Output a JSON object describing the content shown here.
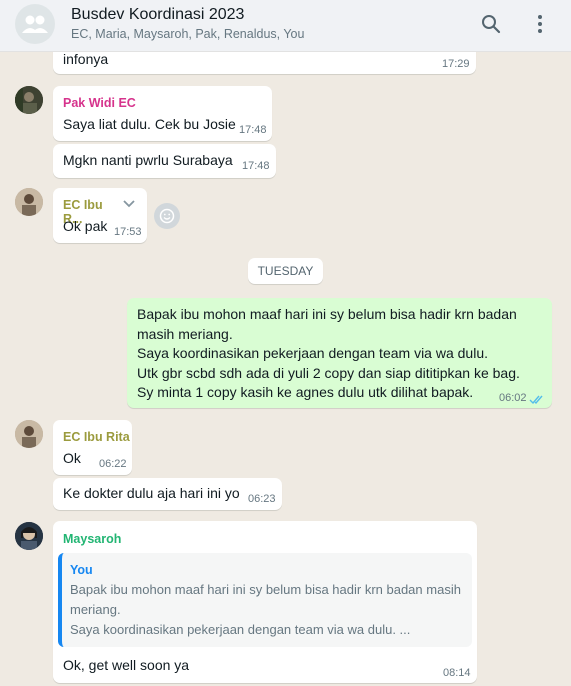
{
  "header": {
    "title": "Busdev Koordinasi 2023",
    "participants": "EC, Maria, Maysaroh, Pak, Renaldus, You",
    "icons": [
      "group-avatar-icon",
      "search-icon",
      "menu-kebab-icon"
    ]
  },
  "colors": {
    "outgoing_bubble": "#d9fdd3",
    "incoming_bubble": "#ffffff",
    "sender_pak_widi": "#d6338c",
    "sender_ec_ibu": "#9b9b3e",
    "sender_maysaroh": "#22b573",
    "quote_bar": "#1687f1",
    "read_ticks": "#53bdeb"
  },
  "messages": [
    {
      "text": "infonya",
      "time": "17:29"
    },
    {
      "sender": "Pak Widi EC",
      "text": "Saya liat dulu. Cek bu Josie",
      "time": "17:48"
    },
    {
      "text": "Mgkn nanti pwrlu Surabaya",
      "time": "17:48"
    },
    {
      "sender": "EC Ibu R...",
      "text": "Ok pak",
      "time": "17:53"
    },
    {
      "text": "Ok",
      "time": "06:22",
      "sender": "EC Ibu Rita"
    },
    {
      "text": "Ke dokter dulu aja hari ini yo",
      "time": "06:23"
    }
  ],
  "date_separator": "TUESDAY",
  "outgoing": {
    "lines": [
      "Bapak ibu mohon maaf hari ini sy belum bisa hadir krn badan",
      "masih meriang.",
      "Saya koordinasikan pekerjaan dengan team via wa dulu.",
      "Utk gbr scbd sdh ada di yuli 2 copy dan siap dititipkan ke bag.",
      "Sy minta 1 copy kasih ke agnes dulu utk dilihat bapak."
    ],
    "time": "06:02"
  },
  "reply": {
    "sender": "Maysaroh",
    "quoted_author": "You",
    "quoted_lines": [
      "Bapak ibu mohon maaf hari ini sy belum bisa hadir krn badan masih",
      "meriang.",
      "Saya koordinasikan pekerjaan dengan team via wa dulu. ..."
    ],
    "text": "Ok, get well soon ya",
    "time": "08:14"
  }
}
